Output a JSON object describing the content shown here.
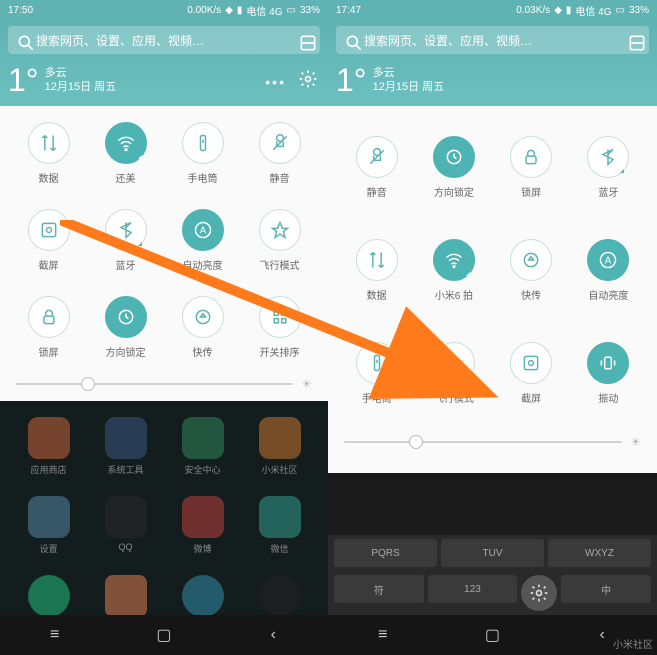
{
  "watermark": "小米社区",
  "left": {
    "statusbar": {
      "time": "17:50",
      "net": "0.00K/s",
      "carrier": "电信 4G",
      "battery": "33%"
    },
    "search": {
      "placeholder": "搜索网页、设置、应用、视频…"
    },
    "weather": {
      "temp": "1°",
      "cond": "多云",
      "date": "12月15日 周五"
    },
    "toggles": [
      {
        "label": "数据",
        "icon": "data",
        "active": false
      },
      {
        "label": "还美",
        "icon": "wifi",
        "active": true,
        "tri": true
      },
      {
        "label": "手电筒",
        "icon": "torch",
        "active": false
      },
      {
        "label": "静音",
        "icon": "mute",
        "active": false
      },
      {
        "label": "截屏",
        "icon": "screenshot",
        "active": false
      },
      {
        "label": "蓝牙",
        "icon": "bluetooth",
        "active": false,
        "tri": true
      },
      {
        "label": "自动亮度",
        "icon": "auto-bright",
        "active": true
      },
      {
        "label": "飞行模式",
        "icon": "airplane",
        "active": false
      },
      {
        "label": "锁屏",
        "icon": "lock",
        "active": false
      },
      {
        "label": "方向锁定",
        "icon": "rotate-lock",
        "active": true
      },
      {
        "label": "快传",
        "icon": "share",
        "active": false
      },
      {
        "label": "开关排序",
        "icon": "reorder",
        "active": false
      }
    ],
    "slider_pct": 26,
    "apps_row1": [
      {
        "label": "应用商店",
        "color": "#d86b3f"
      },
      {
        "label": "系统工具",
        "color": "#3b5b8c"
      },
      {
        "label": "安全中心",
        "color": "#2f8f5f"
      },
      {
        "label": "小米社区",
        "color": "#d87b2f"
      }
    ],
    "apps_row2": [
      {
        "label": "设置",
        "color": "#5a8fb3"
      },
      {
        "label": "QQ",
        "color": "#2a2a2a"
      },
      {
        "label": "微博",
        "color": "#c44"
      },
      {
        "label": "微信",
        "color": "#3a9"
      }
    ]
  },
  "right": {
    "statusbar": {
      "time": "17:47",
      "net": "0.03K/s",
      "carrier": "电信 4G",
      "battery": "33%"
    },
    "search": {
      "placeholder": "搜索网页、设置、应用、视频…"
    },
    "weather": {
      "temp": "1°",
      "cond": "多云",
      "date": "12月15日 周五"
    },
    "toggles": [
      {
        "label": "静音",
        "icon": "mute",
        "active": false
      },
      {
        "label": "方向锁定",
        "icon": "rotate-lock",
        "active": true
      },
      {
        "label": "锁屏",
        "icon": "lock",
        "active": false
      },
      {
        "label": "蓝牙",
        "icon": "bluetooth",
        "active": false,
        "tri": true
      },
      {
        "label": "数据",
        "icon": "data",
        "active": false
      },
      {
        "label": "小米6 拍",
        "icon": "wifi",
        "active": true,
        "tri": true
      },
      {
        "label": "快传",
        "icon": "share",
        "active": false
      },
      {
        "label": "自动亮度",
        "icon": "auto-bright",
        "active": true
      },
      {
        "label": "手电筒",
        "icon": "torch",
        "active": false
      },
      {
        "label": "飞行模式",
        "icon": "airplane",
        "active": false
      },
      {
        "label": "截屏",
        "icon": "screenshot",
        "active": false
      },
      {
        "label": "振动",
        "icon": "vibrate",
        "active": true
      }
    ],
    "slider_pct": 26,
    "kb_row1": [
      "PQRS",
      "TUV",
      "WXYZ"
    ],
    "kb_row2": [
      "符",
      "123",
      "中"
    ]
  }
}
